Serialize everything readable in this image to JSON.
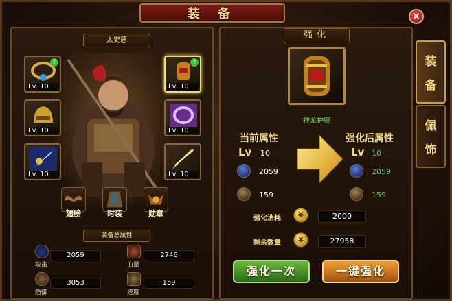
{
  "window": {
    "title": "装 备"
  },
  "hero": {
    "name": "太史慈"
  },
  "equipment_slots": [
    {
      "level": "Lv. 10",
      "upgrade": true,
      "icon": "necklace-icon"
    },
    {
      "level": "Lv. 10",
      "upgrade": false,
      "icon": "helmet-icon"
    },
    {
      "level": "Lv. 10",
      "upgrade": false,
      "icon": "weapon-icon"
    },
    {
      "level": "Lv. 10",
      "upgrade": true,
      "icon": "bracer-icon",
      "selected": true
    },
    {
      "level": "Lv. 10",
      "upgrade": false,
      "icon": "ring-icon"
    },
    {
      "level": "Lv. 10",
      "upgrade": false,
      "icon": "sword-icon"
    }
  ],
  "skills": [
    {
      "label": "翅膀",
      "icon": "wings-icon"
    },
    {
      "label": "时装",
      "icon": "fashion-icon"
    },
    {
      "label": "勋章",
      "icon": "medal-icon"
    }
  ],
  "summary": {
    "title": "装备总属性",
    "stats": [
      {
        "label": "攻击",
        "value": "2059",
        "icon": "attack-icon"
      },
      {
        "label": "血量",
        "value": "2746",
        "icon": "hp-icon"
      },
      {
        "label": "防御",
        "value": "3053",
        "icon": "defense-icon"
      },
      {
        "label": "速度",
        "value": "159",
        "icon": "speed-icon"
      }
    ]
  },
  "strengthen": {
    "title": "强化",
    "item_name": "神龙护腕",
    "current_label": "当前属性",
    "after_label": "强化后属性",
    "lv_label": "Lv",
    "current": {
      "lv": "10",
      "attack": "2059",
      "defense": "159"
    },
    "after": {
      "lv": "10",
      "attack": "2059",
      "defense": "159"
    },
    "cost_label": "强化消耗",
    "cost_value": "2000",
    "remain_label": "剩余数量",
    "remain_value": "27958",
    "btn_once": "强化一次",
    "btn_auto": "一键强化"
  },
  "tabs": [
    {
      "label_top": "装",
      "label_bottom": "备",
      "active": true
    },
    {
      "label_top": "佩",
      "label_bottom": "饰",
      "active": false
    }
  ],
  "close_label": "×"
}
